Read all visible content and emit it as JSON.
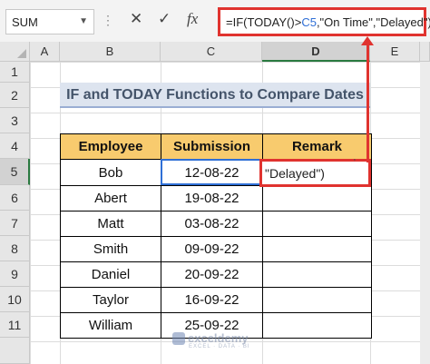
{
  "formula_bar": {
    "name_box": "SUM",
    "cancel_icon": "cancel-icon",
    "enter_icon": "enter-icon",
    "fx_label": "fx",
    "formula_prefix": "=IF(TODAY()>",
    "formula_ref": "C5",
    "formula_suffix": ",\"On Time\",\"Delayed\")"
  },
  "columns": [
    "A",
    "B",
    "C",
    "D",
    "E"
  ],
  "selected_column": "D",
  "rows": [
    "1",
    "2",
    "3",
    "4",
    "5",
    "6",
    "7",
    "8",
    "9",
    "10",
    "11"
  ],
  "selected_row": "5",
  "sheet": {
    "title": "IF and TODAY Functions to Compare Dates",
    "headers": [
      "Employee",
      "Submission",
      "Remark"
    ],
    "rows": [
      {
        "employee": "Bob",
        "submission": "12-08-22"
      },
      {
        "employee": "Abert",
        "submission": "19-08-22"
      },
      {
        "employee": "Matt",
        "submission": "03-08-22"
      },
      {
        "employee": "Smith",
        "submission": "09-09-22"
      },
      {
        "employee": "Daniel",
        "submission": "20-09-22"
      },
      {
        "employee": "Taylor",
        "submission": "16-09-22"
      },
      {
        "employee": "William",
        "submission": "25-09-22"
      }
    ],
    "editing_text": "\"Delayed\")",
    "editing_peek": "’"
  },
  "watermark": {
    "name": "exceldemy",
    "sub": "EXCEL · DATA · BI"
  },
  "colors": {
    "accent_red": "#e0332f",
    "header_orange": "#f8cb6e",
    "title_bg": "#dde4ef",
    "select_green": "#2a7a40",
    "active_blue": "#2f6fd6"
  }
}
